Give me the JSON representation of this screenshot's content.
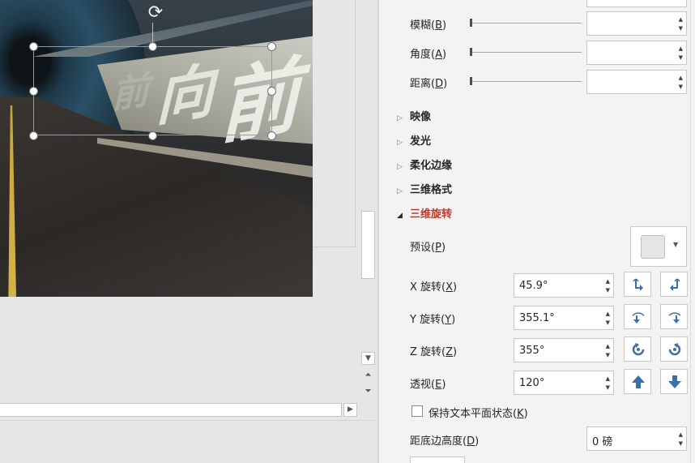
{
  "editor": {
    "slide_text": [
      "前",
      "向",
      "前"
    ]
  },
  "shadow_settings": {
    "blur_label": "模糊(B)",
    "blur_key": "B",
    "blur_name": "模糊",
    "angle_name": "角度",
    "angle_key": "A",
    "distance_name": "距离",
    "distance_key": "D"
  },
  "sections": {
    "reflection": "映像",
    "glow": "发光",
    "soft_edges": "柔化边缘",
    "three_d_format": "三维格式",
    "three_d_rotation": "三维旋转"
  },
  "rotation": {
    "preset_name": "预设",
    "preset_key": "P",
    "x_name": "X 旋转",
    "x_key": "X",
    "x_value": "45.9°",
    "y_name": "Y 旋转",
    "y_key": "Y",
    "y_value": "355.1°",
    "z_name": "Z 旋转",
    "z_key": "Z",
    "z_value": "355°",
    "perspective_name": "透视",
    "perspective_key": "E",
    "perspective_value": "120°",
    "keep_text_flat_name": "保持文本平面状态",
    "keep_text_flat_key": "K",
    "keep_text_flat_checked": false,
    "distance_ground_name": "距底边高度",
    "distance_ground_key": "D",
    "distance_ground_value": "0 磅"
  },
  "colors": {
    "accent_section": "#c0392b",
    "icon_blue": "#3f6fa8",
    "pane_bg": "#f3f3f3"
  }
}
